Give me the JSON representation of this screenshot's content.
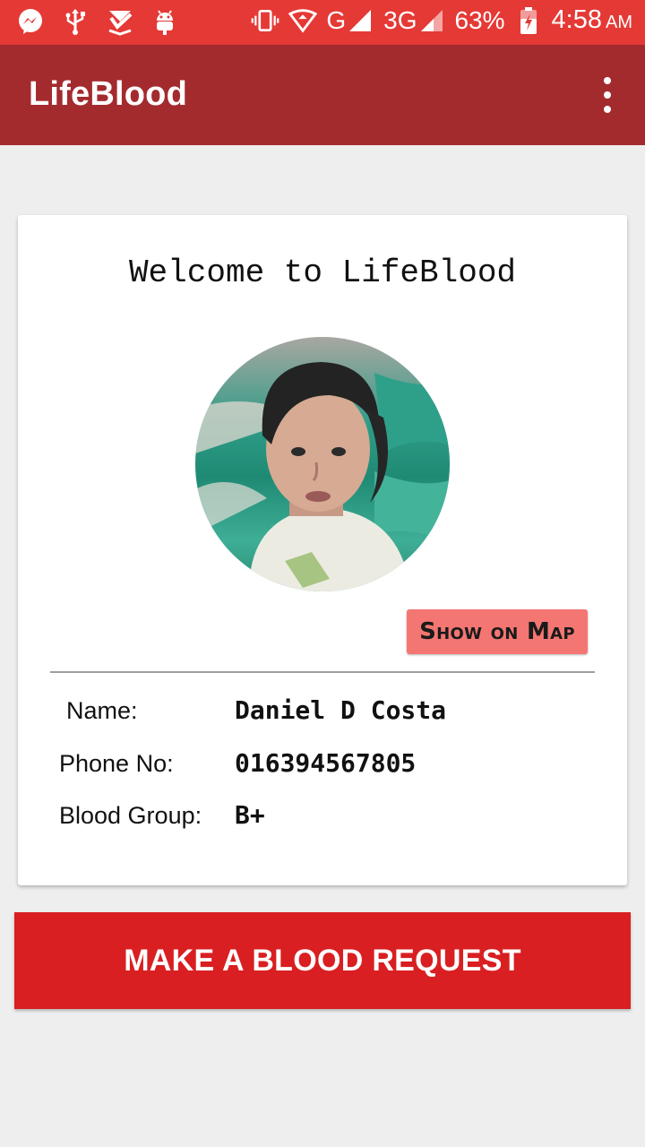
{
  "status_bar": {
    "battery": "63%",
    "time": "4:58",
    "ampm": "AM",
    "network_g": "G",
    "network_3g": "3G",
    "icons": [
      "messenger-icon",
      "usb-icon",
      "download-check-icon",
      "android-debug-icon",
      "vibrate-icon",
      "wifi-icon",
      "signal-icon",
      "signal-icon",
      "battery-charging-icon"
    ]
  },
  "app_bar": {
    "title": "LifeBlood",
    "menu_icon": "more-vert-icon"
  },
  "card": {
    "welcome": "Welcome to LifeBlood",
    "show_on_map": "Show on Map",
    "fields": [
      {
        "label": "Name:",
        "value": "Daniel D Costa"
      },
      {
        "label": "Phone No:",
        "value": "016394567805"
      },
      {
        "label": "Blood Group:",
        "value": "B+"
      }
    ]
  },
  "request_button": "MAKE A BLOOD REQUEST",
  "colors": {
    "status_bar": "#e53935",
    "app_bar": "#a32b2e",
    "map_button": "#f47672",
    "request_button": "#d91f21",
    "background": "#eeeeee"
  }
}
